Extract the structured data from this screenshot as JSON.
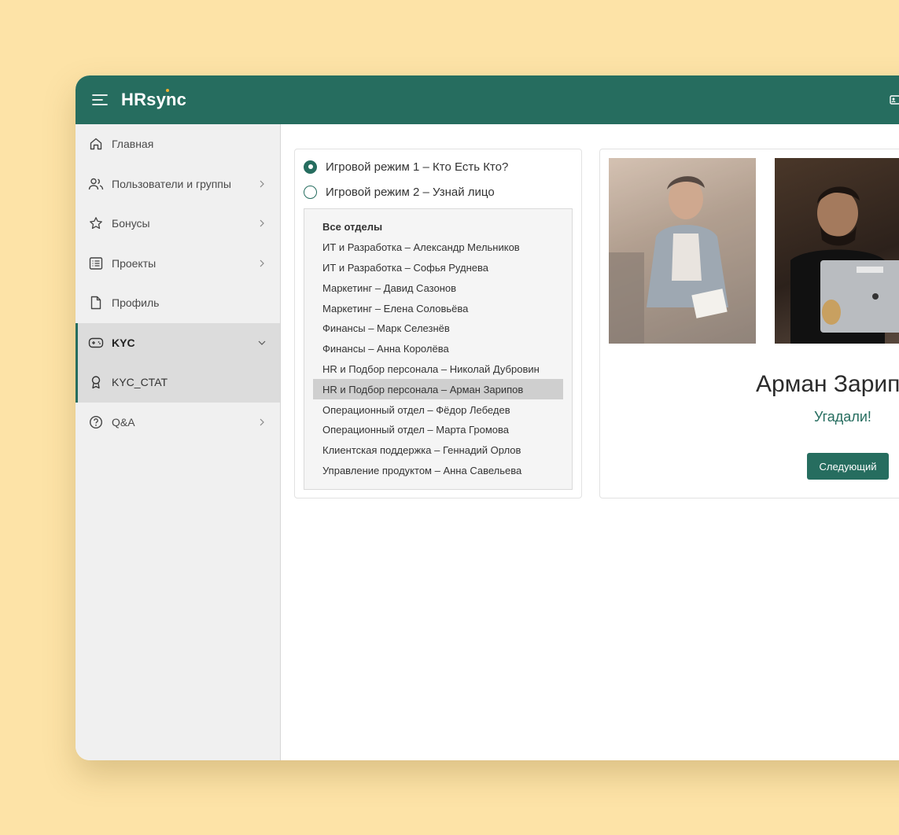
{
  "app": {
    "brand": "HRsync"
  },
  "sidebar": {
    "items": [
      {
        "label": "Главная",
        "icon": "home-icon"
      },
      {
        "label": "Пользователи и группы",
        "icon": "users-icon"
      },
      {
        "label": "Бонусы",
        "icon": "star-icon"
      },
      {
        "label": "Проекты",
        "icon": "list-icon"
      },
      {
        "label": "Профиль",
        "icon": "file-icon"
      },
      {
        "label": "KYC",
        "icon": "gamepad-icon"
      },
      {
        "label": "KYC_CTAT",
        "icon": "badge-icon"
      },
      {
        "label": "Q&A",
        "icon": "help-icon"
      }
    ]
  },
  "game": {
    "modes": [
      {
        "label": "Игровой режим 1 – Кто Есть Кто?",
        "checked": true
      },
      {
        "label": "Игровой режим 2 – Узнай лицо",
        "checked": false
      }
    ],
    "list_header": "Все отделы",
    "list": [
      "ИТ и Разработка – Александр Мельников",
      "ИТ и Разработка – Софья Руднева",
      "Маркетинг – Давид Сазонов",
      "Маркетинг – Елена Соловьёва",
      "Финансы – Марк Селезнёв",
      "Финансы – Анна Королёва",
      "HR и Подбор персонала – Николай Дубровин",
      "HR и Подбор персонала – Арман Зарипов",
      "Операционный отдел – Фёдор Лебедев",
      "Операционный отдел – Марта Громова",
      "Клиентская поддержка – Геннадий Орлов",
      "Управление продуктом – Анна Савельева"
    ],
    "selected_name": "Арман Зарипов",
    "result": "Угадали!",
    "next_label": "Следующий"
  },
  "colors": {
    "accent": "#266d5f",
    "background": "#fde3a7"
  }
}
